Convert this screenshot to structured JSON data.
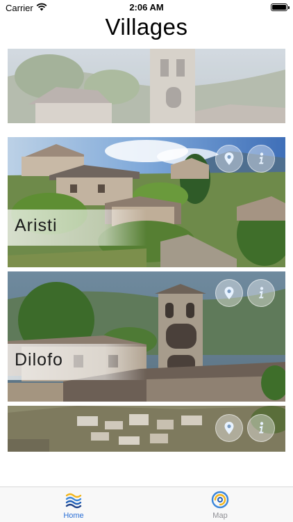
{
  "status_bar": {
    "carrier": "Carrier",
    "time": "2:06 AM"
  },
  "page": {
    "title": "Villages"
  },
  "villages": [
    {
      "name": "",
      "faded": true
    },
    {
      "name": "Aristi",
      "faded": false
    },
    {
      "name": "Dilofo",
      "faded": false
    },
    {
      "name": "",
      "faded": false
    }
  ],
  "card_icons": {
    "location": "location-pin-icon",
    "info": "info-icon"
  },
  "tab_bar": {
    "tabs": [
      {
        "label": "Home",
        "icon": "home-waves-icon",
        "selected": true
      },
      {
        "label": "Map",
        "icon": "map-swirl-icon",
        "selected": false
      }
    ]
  },
  "colors": {
    "accent": "#2b6fd6",
    "inactive": "#8e8e93",
    "icon_fill": "#e8f3ff"
  }
}
